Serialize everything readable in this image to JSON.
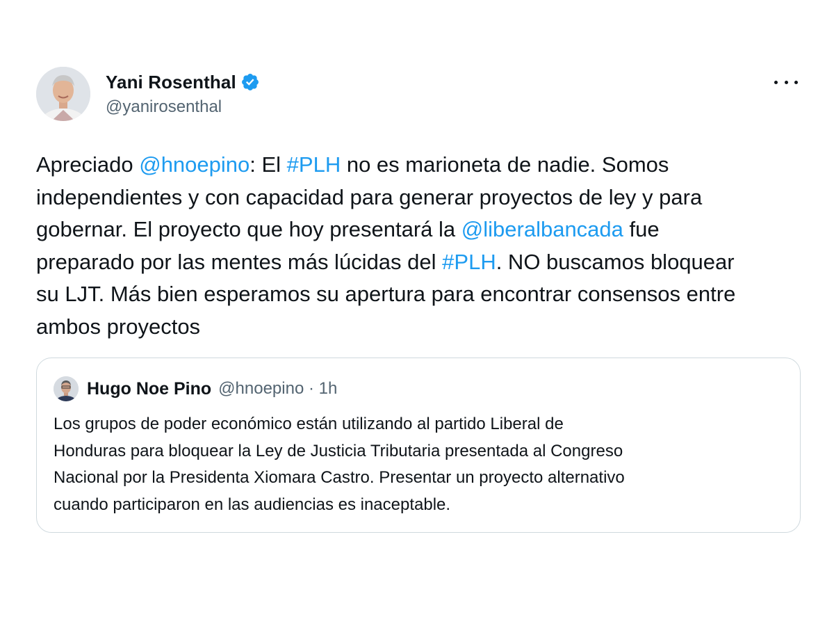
{
  "author": {
    "name": "Yani Rosenthal",
    "handle": "@yanirosenthal",
    "verified_icon": "verified-badge-icon",
    "avatar_icon": "profile-photo-avatar"
  },
  "menu": {
    "icon": "more-options-icon"
  },
  "tweet": {
    "lines": [
      [
        {
          "text": "Apreciado ",
          "link": false
        },
        {
          "text": "@hnoepino",
          "link": true
        },
        {
          "text": ": El ",
          "link": false
        },
        {
          "text": "#PLH",
          "link": true
        },
        {
          "text": " no es marioneta de nadie. Somos",
          "link": false
        }
      ],
      [
        {
          "text": "independientes y con capacidad para generar proyectos de ley y para",
          "link": false
        }
      ],
      [
        {
          "text": "gobernar. El proyecto que hoy presentará la ",
          "link": false
        },
        {
          "text": "@liberalbancada",
          "link": true
        },
        {
          "text": " fue",
          "link": false
        }
      ],
      [
        {
          "text": "preparado por las mentes más lúcidas del ",
          "link": false
        },
        {
          "text": "#PLH",
          "link": true
        },
        {
          "text": ". NO buscamos bloquear",
          "link": false
        }
      ],
      [
        {
          "text": "su LJT. Más bien esperamos su apertura para encontrar consensos entre",
          "link": false
        }
      ],
      [
        {
          "text": "ambos proyectos",
          "link": false
        }
      ]
    ]
  },
  "quoted": {
    "name": "Hugo Noe Pino",
    "meta": "@hnoepino · 1h",
    "avatar_icon": "profile-photo-avatar",
    "lines": [
      "Los grupos de poder económico están utilizando al partido Liberal de",
      "Honduras para bloquear la Ley de Justicia Tributaria presentada al Congreso",
      "Nacional por la Presidenta Xiomara Castro. Presentar un proyecto alternativo",
      "cuando participaron en las audiencias es inaceptable."
    ]
  },
  "colors": {
    "text": "#0f1419",
    "secondary": "#536471",
    "link": "#1d9bf0",
    "border": "#cfd9de",
    "verified": "#1d9bf0"
  }
}
